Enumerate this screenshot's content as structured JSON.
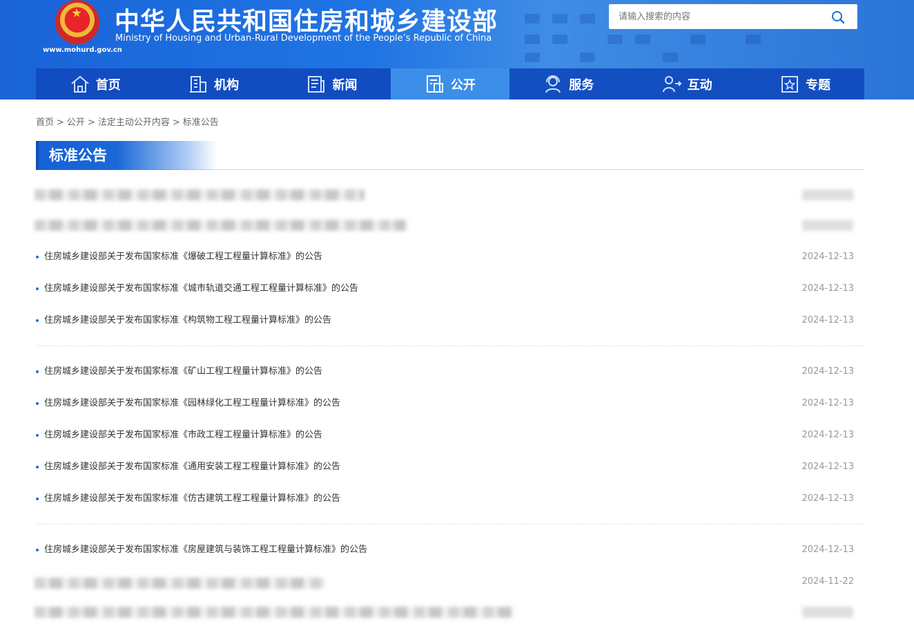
{
  "header": {
    "title_cn": "中华人民共和国住房和城乡建设部",
    "title_en": "Ministry of Housing and Urban-Rural Development of the People’s Republic of China",
    "site_url": "www.mohurd.gov.cn",
    "search_placeholder": "请输入搜索的内容",
    "brand_color": "#1f74e4"
  },
  "nav": {
    "items": [
      {
        "label": "首页",
        "icon": "home-icon"
      },
      {
        "label": "机构",
        "icon": "building-icon"
      },
      {
        "label": "新闻",
        "icon": "news-icon"
      },
      {
        "label": "公开",
        "icon": "disclosure-icon",
        "active": true
      },
      {
        "label": "服务",
        "icon": "service-icon"
      },
      {
        "label": "互动",
        "icon": "interaction-icon"
      },
      {
        "label": "专题",
        "icon": "topic-icon"
      }
    ]
  },
  "breadcrumb": [
    "首页",
    "公开",
    "法定主动公开内容",
    "标准公告"
  ],
  "section_title": "标准公告",
  "list": [
    {
      "title": "住房城乡建设部关于发布国家标准《爆破工程工程量计算标准》的公告",
      "date": "2024-12-13"
    },
    {
      "title": "住房城乡建设部关于发布国家标准《城市轨道交通工程工程量计算标准》的公告",
      "date": "2024-12-13"
    },
    {
      "title": "住房城乡建设部关于发布国家标准《构筑物工程工程量计算标准》的公告",
      "date": "2024-12-13"
    },
    {
      "title": "住房城乡建设部关于发布国家标准《矿山工程工程量计算标准》的公告",
      "date": "2024-12-13"
    },
    {
      "title": "住房城乡建设部关于发布国家标准《园林绿化工程工程量计算标准》的公告",
      "date": "2024-12-13"
    },
    {
      "title": "住房城乡建设部关于发布国家标准《市政工程工程量计算标准》的公告",
      "date": "2024-12-13"
    },
    {
      "title": "住房城乡建设部关于发布国家标准《通用安装工程工程量计算标准》的公告",
      "date": "2024-12-13"
    },
    {
      "title": "住房城乡建设部关于发布国家标准《仿古建筑工程工程量计算标准》的公告",
      "date": "2024-12-13"
    },
    {
      "title": "住房城乡建设部关于发布国家标准《房屋建筑与装饰工程工程量计算标准》的公告",
      "date": "2024-12-13"
    }
  ],
  "partial_dates": [
    "2024-11-22"
  ]
}
